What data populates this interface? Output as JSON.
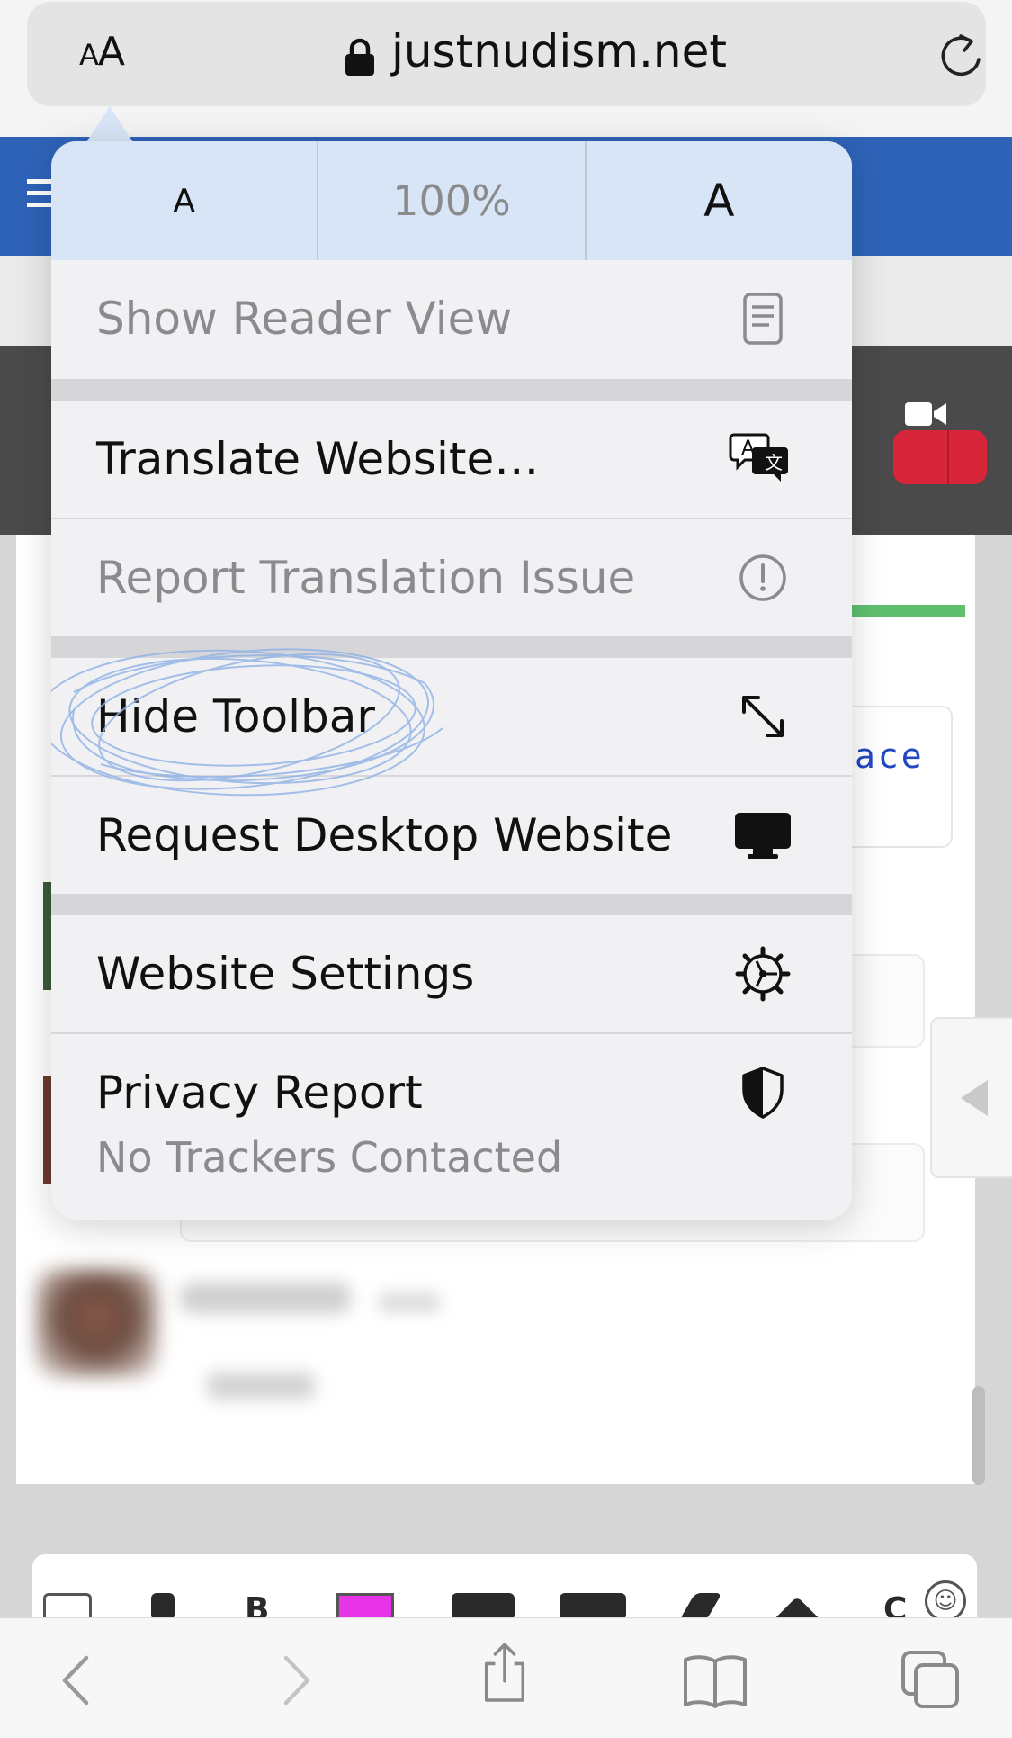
{
  "address_bar": {
    "text_size_button": "AA",
    "url": "justnudism.net",
    "lock_icon": "lock-icon",
    "reload_icon": "reload-icon"
  },
  "page_behind": {
    "partial_link_text": "ace"
  },
  "menu": {
    "zoom": {
      "decrease_label": "A",
      "percent": "100%",
      "increase_label": "A"
    },
    "items": [
      {
        "label": "Show Reader View",
        "icon": "reader-view-icon",
        "enabled": false
      },
      {
        "label": "Translate Website…",
        "icon": "translate-icon",
        "enabled": true
      },
      {
        "label": "Report Translation Issue",
        "icon": "exclamation-circle-icon",
        "enabled": false
      },
      {
        "label": "Hide Toolbar",
        "icon": "expand-arrows-icon",
        "enabled": true
      },
      {
        "label": "Request Desktop Website",
        "icon": "desktop-icon",
        "enabled": true
      },
      {
        "label": "Website Settings",
        "icon": "gear-icon",
        "enabled": true
      },
      {
        "label": "Privacy Report",
        "sublabel": "No Trackers Contacted",
        "icon": "shield-icon",
        "enabled": true
      }
    ]
  },
  "toolbar": {
    "buttons": [
      "back-icon",
      "forward-icon",
      "share-icon",
      "bookmarks-icon",
      "tabs-icon"
    ]
  },
  "colors": {
    "accent_blue": "#2f63b8",
    "zoom_row_bg": "#d7e5f6",
    "scribble": "#8fb2e6",
    "red_button": "#d9253a"
  }
}
